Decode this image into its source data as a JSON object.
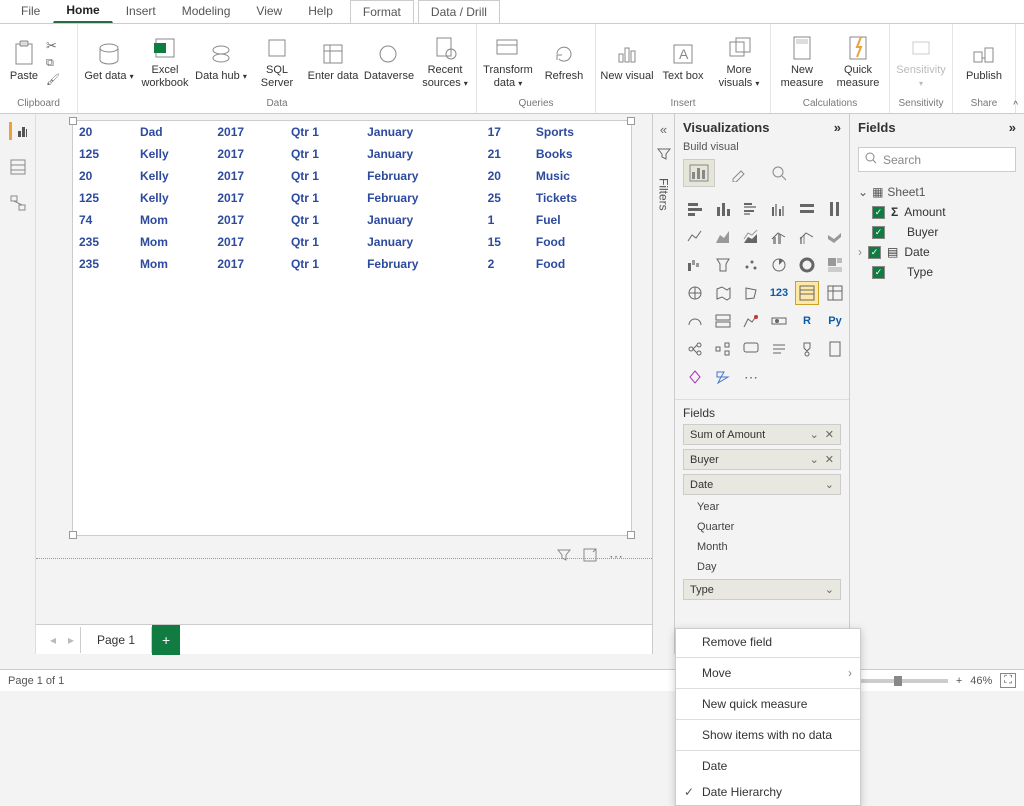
{
  "tabs": {
    "file": "File",
    "home": "Home",
    "insert": "Insert",
    "modeling": "Modeling",
    "view": "View",
    "help": "Help",
    "format": "Format",
    "datadrill": "Data / Drill"
  },
  "ribbon": {
    "clipboard": {
      "label": "Clipboard",
      "paste": "Paste"
    },
    "data": {
      "label": "Data",
      "get": "Get data",
      "excel": "Excel workbook",
      "hub": "Data hub",
      "sql": "SQL Server",
      "enter": "Enter data",
      "dataverse": "Dataverse",
      "recent": "Recent sources"
    },
    "queries": {
      "label": "Queries",
      "transform": "Transform data",
      "refresh": "Refresh"
    },
    "insert": {
      "label": "Insert",
      "newvis": "New visual",
      "textbox": "Text box",
      "more": "More visuals"
    },
    "calc": {
      "label": "Calculations",
      "newmeas": "New measure",
      "quick": "Quick measure"
    },
    "sens": {
      "label": "Sensitivity",
      "btn": "Sensitivity"
    },
    "share": {
      "label": "Share",
      "publish": "Publish"
    }
  },
  "table": {
    "rows": [
      [
        "20",
        "Dad",
        "2017",
        "Qtr 1",
        "January",
        "17",
        "Sports"
      ],
      [
        "125",
        "Kelly",
        "2017",
        "Qtr 1",
        "January",
        "21",
        "Books"
      ],
      [
        "20",
        "Kelly",
        "2017",
        "Qtr 1",
        "February",
        "20",
        "Music"
      ],
      [
        "125",
        "Kelly",
        "2017",
        "Qtr 1",
        "February",
        "25",
        "Tickets"
      ],
      [
        "74",
        "Mom",
        "2017",
        "Qtr 1",
        "January",
        "1",
        "Fuel"
      ],
      [
        "235",
        "Mom",
        "2017",
        "Qtr 1",
        "January",
        "15",
        "Food"
      ],
      [
        "235",
        "Mom",
        "2017",
        "Qtr 1",
        "February",
        "2",
        "Food"
      ]
    ]
  },
  "page": {
    "name": "Page 1",
    "status": "Page 1 of 1",
    "zoom": "46%"
  },
  "filters": {
    "label": "Filters"
  },
  "visPane": {
    "title": "Visualizations",
    "sub": "Build visual",
    "fieldsLabel": "Fields",
    "wells": {
      "amount": "Sum of Amount",
      "buyer": "Buyer",
      "date": "Date",
      "year": "Year",
      "quarter": "Quarter",
      "month": "Month",
      "day": "Day",
      "type": "Type"
    }
  },
  "fieldsPane": {
    "title": "Fields",
    "search": "Search",
    "sheet": "Sheet1",
    "amount": "Amount",
    "buyer": "Buyer",
    "date": "Date",
    "type": "Type"
  },
  "ctx": {
    "remove": "Remove field",
    "move": "Move",
    "newquick": "New quick measure",
    "showitems": "Show items with no data",
    "date": "Date",
    "datehier": "Date Hierarchy"
  }
}
